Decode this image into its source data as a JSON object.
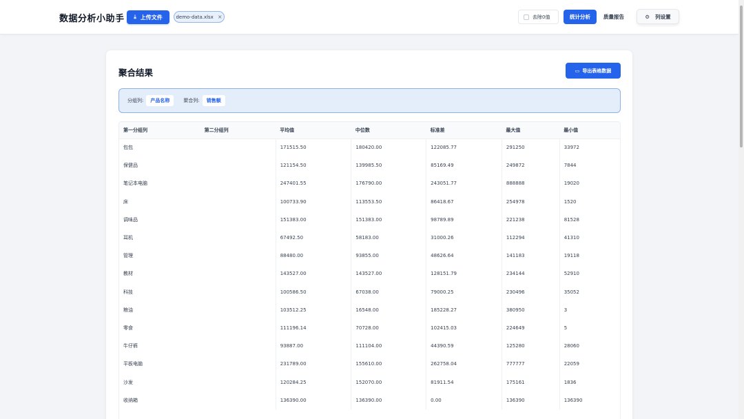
{
  "header": {
    "app_title": "数据分析小助手",
    "upload_label": "上传文件",
    "file_name": "demo-data.xlsx",
    "remove_zero_label": "去除0值",
    "tabs": [
      {
        "label": "统计分析",
        "active": true
      },
      {
        "label": "质量报告",
        "active": false
      }
    ],
    "column_settings_label": "列设置"
  },
  "card": {
    "title": "聚合结果",
    "export_label": "导出表格数据",
    "group_col_label": "分组列:",
    "group_col_value": "产品名称",
    "agg_col_label": "聚合列:",
    "agg_col_value": "销售额"
  },
  "table": {
    "columns": [
      "第一分组列",
      "第二分组列",
      "平均值",
      "中位数",
      "标准差",
      "最大值",
      "最小值"
    ],
    "rows": [
      [
        "包包",
        "",
        "171515.50",
        "180420.00",
        "122085.77",
        "291250",
        "33972"
      ],
      [
        "保健品",
        "",
        "121154.50",
        "139985.50",
        "85169.49",
        "249872",
        "7844"
      ],
      [
        "笔记本电脑",
        "",
        "247401.55",
        "176790.00",
        "243051.77",
        "888888",
        "19020"
      ],
      [
        "床",
        "",
        "100733.90",
        "113553.50",
        "86418.67",
        "254978",
        "1520"
      ],
      [
        "调味品",
        "",
        "151383.00",
        "151383.00",
        "98789.89",
        "221238",
        "81528"
      ],
      [
        "耳机",
        "",
        "67492.50",
        "58183.00",
        "31000.26",
        "112294",
        "41310"
      ],
      [
        "管理",
        "",
        "88480.00",
        "93855.00",
        "48626.64",
        "141183",
        "19118"
      ],
      [
        "教材",
        "",
        "143527.00",
        "143527.00",
        "128151.79",
        "234144",
        "52910"
      ],
      [
        "科技",
        "",
        "100586.50",
        "67038.00",
        "79000.25",
        "230496",
        "35052"
      ],
      [
        "粮油",
        "",
        "103512.25",
        "16548.00",
        "185228.27",
        "380950",
        "3"
      ],
      [
        "零食",
        "",
        "111196.14",
        "70728.00",
        "102415.03",
        "224649",
        "5"
      ],
      [
        "牛仔裤",
        "",
        "93887.00",
        "111104.00",
        "44390.59",
        "125280",
        "28060"
      ],
      [
        "平板电脑",
        "",
        "231789.00",
        "155610.00",
        "262758.04",
        "777777",
        "22059"
      ],
      [
        "沙发",
        "",
        "120284.25",
        "152070.00",
        "81911.54",
        "175161",
        "1836"
      ],
      [
        "收纳箱",
        "",
        "136390.00",
        "136390.00",
        "0.00",
        "136390",
        "136390"
      ]
    ]
  },
  "colors": {
    "primary": "#2563eb",
    "page_bg": "#f3f4f7",
    "filter_bg": "#e4eefb"
  }
}
